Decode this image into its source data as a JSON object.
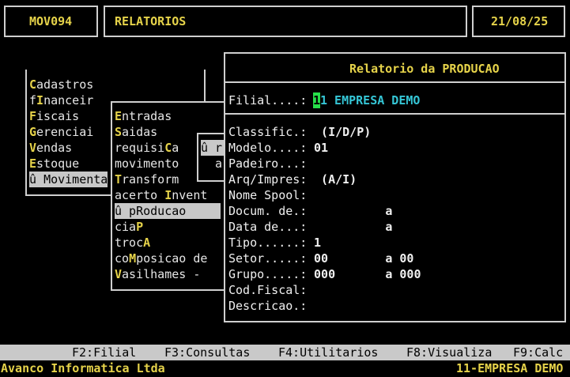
{
  "header": {
    "program_code": "MOV094",
    "module_title": "RELATORIOS",
    "date": "21/08/25"
  },
  "main_menu": {
    "items": [
      {
        "pre": "",
        "hk": "C",
        "post": "adastros"
      },
      {
        "pre": "f",
        "hk": "I",
        "post": "nanceir"
      },
      {
        "pre": "",
        "hk": "F",
        "post": "iscais"
      },
      {
        "pre": "",
        "hk": "G",
        "post": "erenciai"
      },
      {
        "pre": "",
        "hk": "V",
        "post": "endas"
      },
      {
        "pre": "",
        "hk": "E",
        "post": "stoque"
      },
      {
        "pre": "û ",
        "hk": "M",
        "post": "ovimenta"
      }
    ]
  },
  "sub_menu": {
    "items": [
      {
        "pre": "",
        "hk": "E",
        "post": "ntradas"
      },
      {
        "pre": "",
        "hk": "S",
        "post": "aidas"
      },
      {
        "pre": "requisi",
        "hk": "C",
        "post": "a"
      },
      {
        "pre": "movimento",
        "hk": "",
        "post": ""
      },
      {
        "pre": "",
        "hk": "T",
        "post": "ransform"
      },
      {
        "pre": "acerto ",
        "hk": "I",
        "post": "nvent"
      },
      {
        "pre": "û p",
        "hk": "R",
        "post": "oducao"
      },
      {
        "pre": "cia",
        "hk": "P",
        "post": ""
      },
      {
        "pre": "troc",
        "hk": "A",
        "post": ""
      },
      {
        "pre": "co",
        "hk": "M",
        "post": "posicao de"
      },
      {
        "pre": "",
        "hk": "V",
        "post": "asilhames -"
      }
    ]
  },
  "small_popup": {
    "line1": "û r",
    "line2": "a"
  },
  "report_dialog": {
    "title": "Relatorio da PRODUCAO",
    "filial_label": "Filial....:",
    "filial_cursor": "1",
    "filial_value": "1 EMPRESA DEMO",
    "fields": [
      {
        "label": "Classific.:",
        "value": "  (I/D/P)"
      },
      {
        "label": "Modelo....:",
        "value": " 01"
      },
      {
        "label": "Padeiro...:",
        "value": ""
      },
      {
        "label": "Arq/Impres:",
        "value": "  (A/I)"
      },
      {
        "label": "Nome Spool:",
        "value": ""
      },
      {
        "label": "Docum. de.:",
        "value": "           a"
      },
      {
        "label": "Data de...:",
        "value": "           a"
      },
      {
        "label": "Tipo......:",
        "value": " 1"
      },
      {
        "label": "Setor.....:",
        "value": " 00        a 00"
      },
      {
        "label": "Grupo.....:",
        "value": " 000       a 000"
      },
      {
        "label": "Cod.Fiscal:",
        "value": ""
      },
      {
        "label": "Descricao.:",
        "value": ""
      }
    ]
  },
  "function_keys": [
    {
      "key": "F2",
      "label": "F2:Filial"
    },
    {
      "key": "F3",
      "label": "F3:Consultas"
    },
    {
      "key": "F4",
      "label": "F4:Utilitarios"
    },
    {
      "key": "F8",
      "label": "F8:Visualiza"
    },
    {
      "key": "F9",
      "label": "F9:Calc"
    }
  ],
  "status_bar": {
    "company": "Avanco Informatica Ltda",
    "branch": "11-EMPRESA DEMO"
  },
  "colors": {
    "background": "#000000",
    "highlight_text": "#e6d34a",
    "value_text": "#35c6d6",
    "cursor": "#27e04a",
    "menu_selection": "#c8c8c8"
  }
}
